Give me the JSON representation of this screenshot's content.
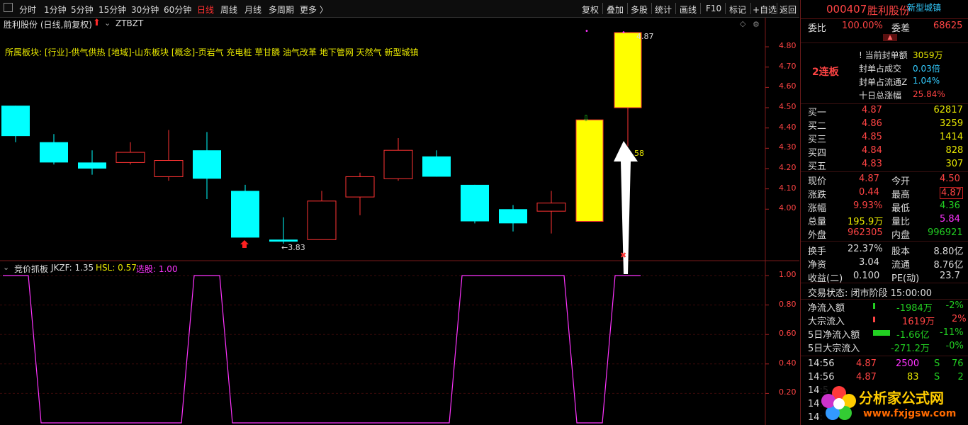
{
  "toolbar": {
    "left_items": [
      "分时",
      "1分钟",
      "5分钟",
      "15分钟",
      "30分钟",
      "60分钟",
      "日线",
      "周线",
      "月线",
      "多周期",
      "更多 〉"
    ],
    "active": "日线",
    "right_items": [
      "复权",
      "叠加",
      "多股",
      "统计",
      "画线",
      "F10",
      "标记",
      "+自选",
      "返回"
    ]
  },
  "chart_header": {
    "title": "胜利股份 (日线,前复权)",
    "indicator": "ZTBZT",
    "sectors": "所属板块: [行业]-供气供热 [地域]-山东板块 [概念]-页岩气 充电桩 草甘膦 油气改革 地下管网 天然气 新型城镇"
  },
  "price_axis": [
    "4.80",
    "4.70",
    "4.60",
    "4.50",
    "4.40",
    "4.30",
    "4.20",
    "4.10",
    "4.00"
  ],
  "annotations": {
    "high_label": "4.87",
    "low_label": "←3.83",
    "mid_label": "58"
  },
  "chart_data": {
    "type": "candlestick",
    "ylim": [
      3.83,
      4.87
    ],
    "candles": [
      {
        "o": 4.36,
        "c": 4.51,
        "h": 4.51,
        "l": 4.33,
        "color": "cyan"
      },
      {
        "o": 4.33,
        "c": 4.23,
        "h": 4.37,
        "l": 4.22,
        "color": "cyan"
      },
      {
        "o": 4.23,
        "c": 4.2,
        "h": 4.29,
        "l": 4.17,
        "color": "cyan"
      },
      {
        "o": 4.23,
        "c": 4.28,
        "h": 4.33,
        "l": 4.22,
        "color": "red"
      },
      {
        "o": 4.16,
        "c": 4.24,
        "h": 4.39,
        "l": 4.14,
        "color": "red"
      },
      {
        "o": 4.29,
        "c": 4.15,
        "h": 4.38,
        "l": 4.05,
        "color": "cyan"
      },
      {
        "o": 4.09,
        "c": 3.86,
        "h": 4.12,
        "l": 3.86,
        "color": "cyan"
      },
      {
        "o": 3.85,
        "c": 3.84,
        "h": 3.96,
        "l": 3.83,
        "color": "cyan"
      },
      {
        "o": 3.85,
        "c": 4.04,
        "h": 4.09,
        "l": 3.85,
        "color": "red"
      },
      {
        "o": 4.06,
        "c": 4.16,
        "h": 4.18,
        "l": 3.97,
        "color": "red"
      },
      {
        "o": 4.15,
        "c": 4.29,
        "h": 4.35,
        "l": 4.14,
        "color": "red"
      },
      {
        "o": 4.26,
        "c": 4.16,
        "h": 4.29,
        "l": 4.16,
        "color": "cyan"
      },
      {
        "o": 4.12,
        "c": 3.94,
        "h": 4.12,
        "l": 3.93,
        "color": "cyan"
      },
      {
        "o": 4.0,
        "c": 3.93,
        "h": 4.02,
        "l": 3.89,
        "color": "cyan"
      },
      {
        "o": 3.99,
        "c": 4.03,
        "h": 4.09,
        "l": 3.88,
        "color": "red"
      },
      {
        "o": 3.94,
        "c": 4.44,
        "h": 4.44,
        "l": 3.94,
        "color": "yellow"
      },
      {
        "o": 4.5,
        "c": 4.87,
        "h": 4.87,
        "l": 4.31,
        "color": "yellow"
      }
    ],
    "indicator": {
      "name": "竞价抓板",
      "labels": [
        {
          "text": "JKZF: 1.35",
          "color": "#dddddd"
        },
        {
          "text": "HSL: 0.57",
          "color": "#e8e800"
        },
        {
          "text": "选股: 1.00",
          "color": "#ff33ff"
        }
      ],
      "yaxis": [
        "1.00",
        "0.80",
        "0.60",
        "0.40",
        "0.20"
      ],
      "ylim": [
        0,
        1.0
      ],
      "values": [
        1,
        0,
        0,
        0,
        0,
        1,
        0,
        0,
        0,
        0,
        0,
        0,
        1,
        1,
        1,
        0,
        1
      ]
    }
  },
  "panel": {
    "code": "000407",
    "name": "胜利股份",
    "tag": "新型城镇",
    "weibi_label": "委比",
    "weibi": "100.00%",
    "weicha_label": "委差",
    "weicha": "68625",
    "lianban": "2连板",
    "seal": [
      {
        "label": "当前封单额",
        "value": "3059万",
        "color": "#e8e800"
      },
      {
        "label": "封单占成交",
        "value": "0.03倍",
        "color": "#33ccff"
      },
      {
        "label": "封单占流通Z",
        "value": "1.04%",
        "color": "#33ccff"
      },
      {
        "label": "十日总涨幅",
        "value": "25.84%",
        "color": "#ff4444"
      }
    ],
    "bids": [
      {
        "label": "买一",
        "price": "4.87",
        "vol": "62817"
      },
      {
        "label": "买二",
        "price": "4.86",
        "vol": "3259"
      },
      {
        "label": "买三",
        "price": "4.85",
        "vol": "1414"
      },
      {
        "label": "买四",
        "price": "4.84",
        "vol": "828"
      },
      {
        "label": "买五",
        "price": "4.83",
        "vol": "307"
      }
    ],
    "quote": [
      {
        "l1": "现价",
        "v1": "4.87",
        "c1": "#ff4444",
        "l2": "今开",
        "v2": "4.50",
        "c2": "#ff4444"
      },
      {
        "l1": "涨跌",
        "v1": "0.44",
        "c1": "#ff4444",
        "l2": "最高",
        "v2": "4.87",
        "c2": "#ff4444"
      },
      {
        "l1": "涨幅",
        "v1": "9.93%",
        "c1": "#ff4444",
        "l2": "最低",
        "v2": "4.36",
        "c2": "#22d022"
      },
      {
        "l1": "总量",
        "v1": "195.9万",
        "c1": "#e8e800",
        "l2": "量比",
        "v2": "5.84",
        "c2": "#ff33ff"
      },
      {
        "l1": "外盘",
        "v1": "962305",
        "c1": "#ff4444",
        "l2": "内盘",
        "v2": "996921",
        "c2": "#22d022"
      }
    ],
    "fund": [
      {
        "l1": "换手",
        "v1": "22.37%",
        "l2": "股本",
        "v2": "8.80亿"
      },
      {
        "l1": "净资",
        "v1": "3.04",
        "l2": "流通",
        "v2": "8.76亿"
      },
      {
        "l1": "收益(二)",
        "v1": "0.100",
        "l2": "PE(动)",
        "v2": "23.7"
      }
    ],
    "trade_state": "交易状态: 闭市阶段 15:00:00",
    "flows": [
      {
        "label": "净流入额",
        "value": "-1984万",
        "pct": "-2%",
        "vcolor": "#22d022",
        "bar": "#22d022",
        "bw": 3
      },
      {
        "label": "大宗流入",
        "value": "1619万",
        "pct": "2%",
        "vcolor": "#ff4444",
        "bar": "#ff4444",
        "bw": 3
      },
      {
        "label": "5日净流入额",
        "value": "-1.66亿",
        "pct": "-11%",
        "vcolor": "#22d022",
        "bar": "#22d022",
        "bw": 24
      },
      {
        "label": "5日大宗流入",
        "value": "-271.2万",
        "pct": "-0%",
        "vcolor": "#22d022",
        "bar": "#22d022",
        "bw": 0
      }
    ],
    "ticks": [
      {
        "time": "14:56",
        "price": "4.87",
        "vol": "2500",
        "vcolor": "#ff33ff",
        "side": "S",
        "n": "76"
      },
      {
        "time": "14:56",
        "price": "4.87",
        "vol": "83",
        "vcolor": "#e8e800",
        "side": "S",
        "n": "2"
      },
      {
        "time": "14:5",
        "price": "",
        "vol": "",
        "vcolor": "#e8e800",
        "side": "",
        "n": ""
      },
      {
        "time": "14:",
        "price": "",
        "vol": "",
        "vcolor": "#e8e800",
        "side": "",
        "n": ""
      },
      {
        "time": "14:",
        "price": "",
        "vol": "",
        "vcolor": "#e8e800",
        "side": "",
        "n": ""
      },
      {
        "time": "14:",
        "price": "",
        "vol": "",
        "vcolor": "#e8e800",
        "side": "",
        "n": ""
      }
    ]
  },
  "watermark": {
    "title": "分析家公式网",
    "url": "www.fxjgsw.com"
  }
}
